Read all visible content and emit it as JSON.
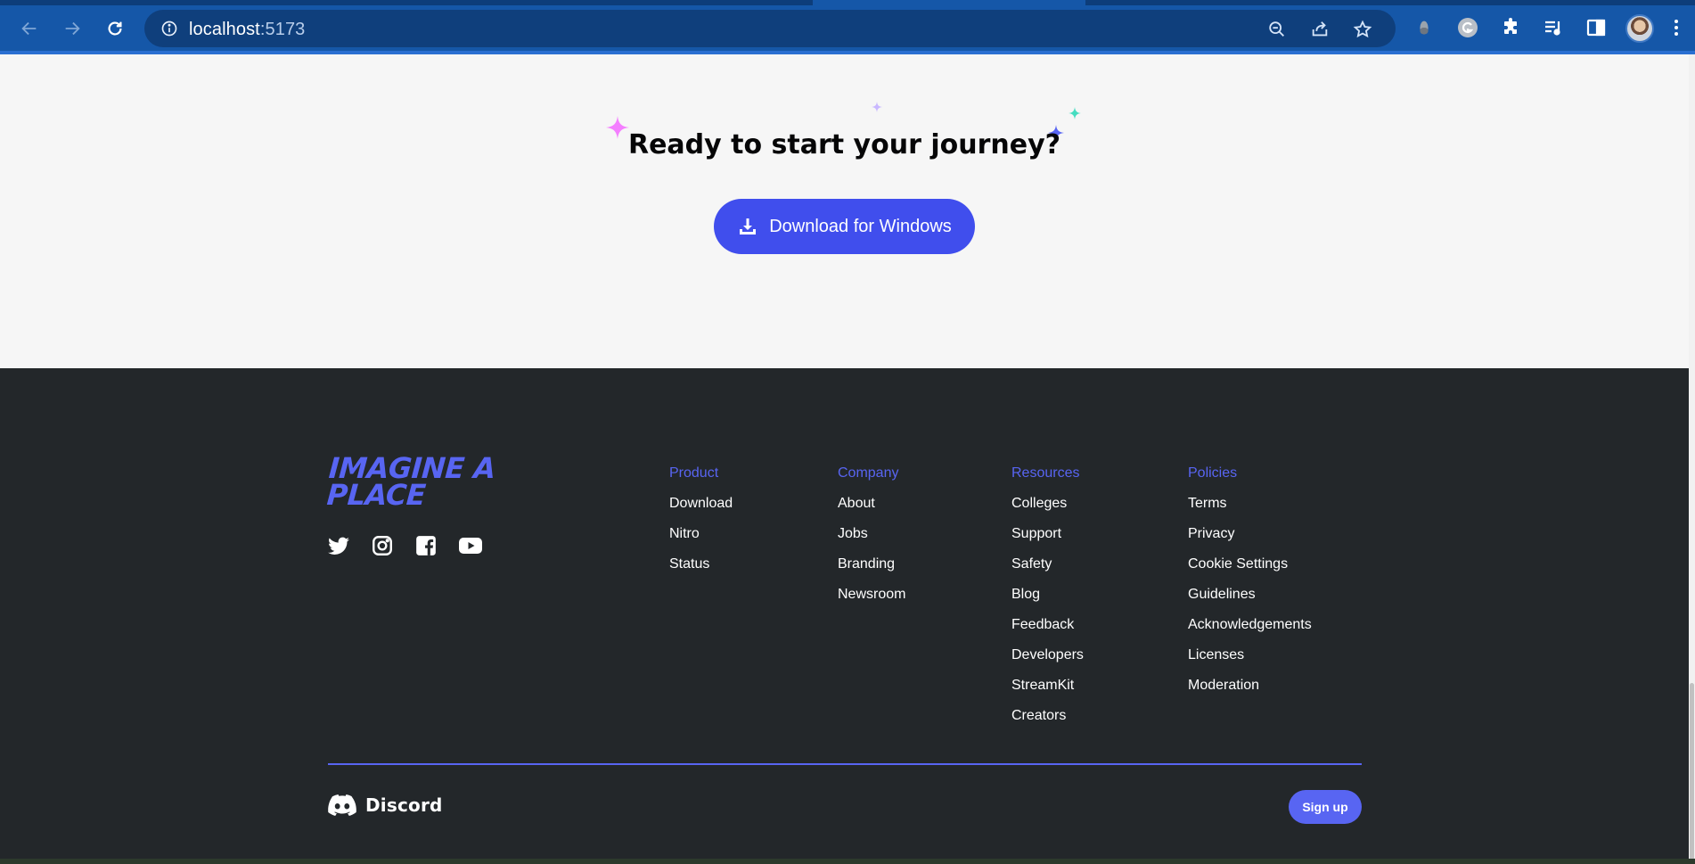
{
  "browser": {
    "url_host": "localhost",
    "url_port": ":5173"
  },
  "hero": {
    "title": "Ready to start your journey?",
    "download_label": "Download for Windows",
    "sparkle_colors": [
      "#f47fff",
      "#c9b8ff",
      "#45ddc0",
      "#5865f2"
    ]
  },
  "footer": {
    "tagline": "IMAGINE A PLACE",
    "social_icons": [
      "twitter-icon",
      "instagram-icon",
      "facebook-icon",
      "youtube-icon"
    ],
    "columns": [
      {
        "heading": "Product",
        "links": [
          "Download",
          "Nitro",
          "Status"
        ]
      },
      {
        "heading": "Company",
        "links": [
          "About",
          "Jobs",
          "Branding",
          "Newsroom"
        ]
      },
      {
        "heading": "Resources",
        "links": [
          "Colleges",
          "Support",
          "Safety",
          "Blog",
          "Feedback",
          "Developers",
          "StreamKit",
          "Creators"
        ]
      },
      {
        "heading": "Policies",
        "links": [
          "Terms",
          "Privacy",
          "Cookie Settings",
          "Guidelines",
          "Acknowledgements",
          "Licenses",
          "Moderation"
        ]
      }
    ],
    "brand_name": "Discord",
    "signup_label": "Sign up"
  },
  "colors": {
    "accent": "#5865f2",
    "button": "#404eed",
    "footer_bg": "#23272a",
    "hero_bg": "#f6f6f6",
    "chrome": "#1557a8"
  }
}
